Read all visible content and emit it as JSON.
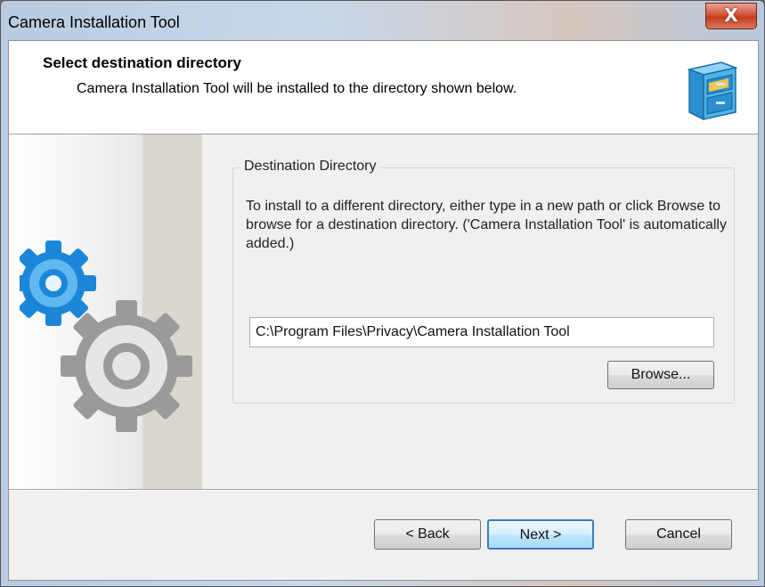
{
  "window": {
    "title": "Camera Installation Tool",
    "close_glyph": "X"
  },
  "header": {
    "title": "Select destination directory",
    "subtitle": "Camera Installation Tool will be installed to the directory shown below.",
    "icon": "file-cabinet-icon"
  },
  "side_panel": {
    "icon": "gears-icon"
  },
  "destination_group": {
    "legend": "Destination Directory",
    "description": "To install to a different directory, either type in a new path or click Browse to browse for a destination directory. ('Camera Installation Tool' is automatically added.)",
    "path_value": "C:\\Program Files\\Privacy\\Camera Installation Tool",
    "browse_label": "Browse..."
  },
  "footer": {
    "back_label": "< Back",
    "next_label": "Next >",
    "cancel_label": "Cancel"
  },
  "colors": {
    "accent": "#3c7fb1",
    "close_red": "#c33b1f",
    "gear_blue": "#1e8fe0",
    "gear_gray": "#8a8a8a"
  }
}
